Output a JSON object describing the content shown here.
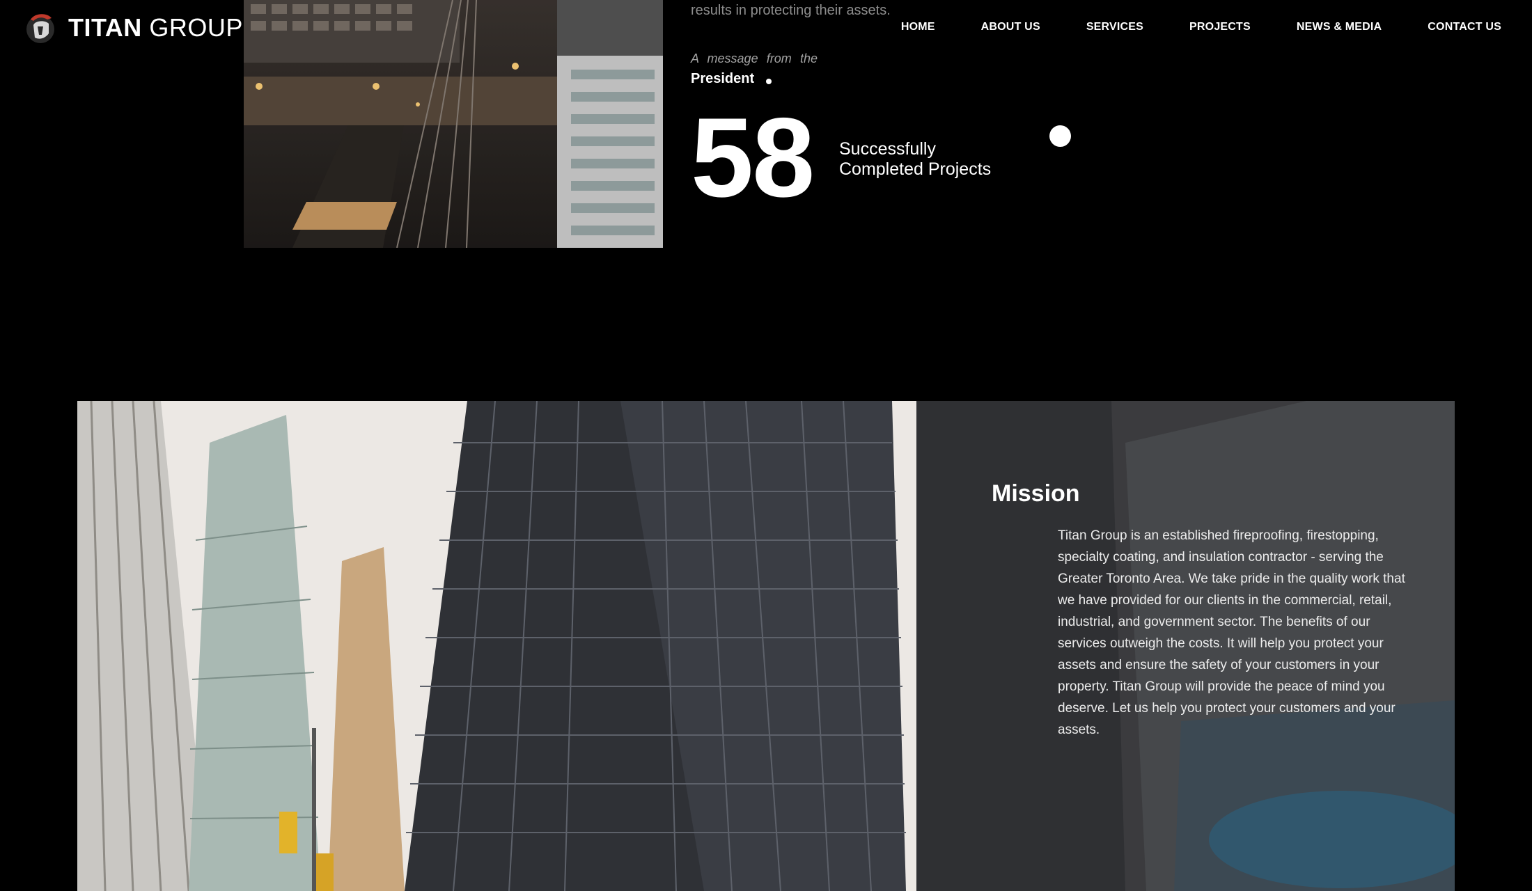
{
  "brand": {
    "name_bold": "TITAN",
    "name_light": "GROUP",
    "logo_icon": "spartan-helmet-logo"
  },
  "nav": {
    "items": [
      "HOME",
      "ABOUT US",
      "SERVICES",
      "PROJECTS",
      "NEWS & MEDIA",
      "CONTACT US"
    ]
  },
  "intro": {
    "assets_line": "results in protecting their assets.",
    "message_line": "A message from the",
    "president": "President"
  },
  "stat": {
    "number": "58",
    "label_line1": "Successfully",
    "label_line2": "Completed Projects"
  },
  "mission": {
    "title": "Mission",
    "body": "Titan Group is an established fireproofing, firestopping, specialty coating, and insulation contractor - serving the Greater Toronto Area. We take pride in the quality work that we have provided for our clients in the commercial, retail, industrial, and government sector. The benefits of our services outweigh the costs. It will help you protect your assets and ensure the safety of your customers in your property. Titan Group will provide the peace of mind you deserve. Let us help you protect your customers and your assets."
  },
  "colors": {
    "background": "#000000",
    "text": "#ffffff",
    "muted_text": "#8d8d8d",
    "overlay": "#3a3a3c"
  }
}
